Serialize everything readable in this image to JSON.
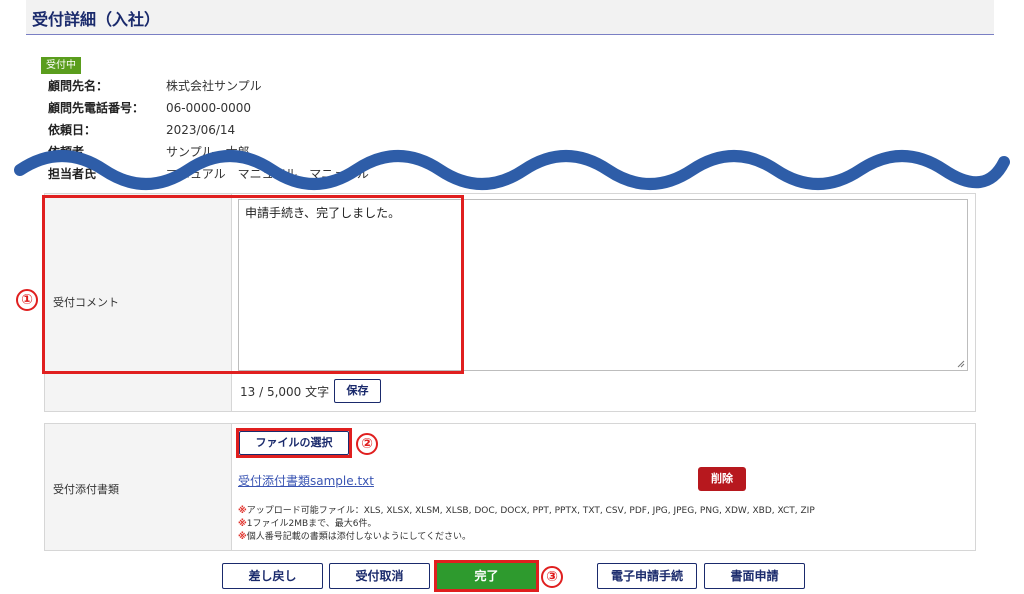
{
  "page": {
    "title": "受付詳細（入社）"
  },
  "status": {
    "badge": "受付中"
  },
  "info": [
    {
      "label": "顧問先名：",
      "value": "株式会社サンプル"
    },
    {
      "label": "顧問先電話番号：",
      "value": "06-0000-0000"
    },
    {
      "label": "依頼日：",
      "value": "2023/06/14"
    },
    {
      "label": "依頼者",
      "value": "サンプル　太郎"
    },
    {
      "label": "担当者氏",
      "value": "マニュアル　マニュアル　マニュアル"
    }
  ],
  "comment": {
    "label": "受付コメント",
    "value": "申請手続き、完了しました。",
    "count": "13 / 5,000 文字",
    "save_label": "保存"
  },
  "attachments": {
    "label": "受付添付書類",
    "choose_file_label": "ファイルの選択",
    "file_name": "受付添付書類sample.txt",
    "delete_label": "削除",
    "note_mark": "※",
    "notes": [
      "アップロード可能ファイル：XLS, XLSX, XLSM, XLSB, DOC, DOCX, PPT, PPTX, TXT, CSV, PDF, JPG, JPEG, PNG, XDW, XBD, XCT, ZIP",
      "1ファイル2MBまで、最大6件。",
      "個人番号記載の書類は添付しないようにしてください。"
    ]
  },
  "actions": {
    "return_label": "差し戻し",
    "cancel_label": "受付取消",
    "complete_label": "完了",
    "e_apply_label": "電子申請手続",
    "paper_apply_label": "書面申請"
  },
  "callouts": [
    "①",
    "②",
    "③"
  ],
  "colors": {
    "accent": "#1a2a6c",
    "status_green": "#5a9d1d",
    "complete_green": "#2e9a2e",
    "delete_red": "#b7181e",
    "highlight_red": "#e01f1f",
    "wave_blue": "#2e5da8"
  }
}
